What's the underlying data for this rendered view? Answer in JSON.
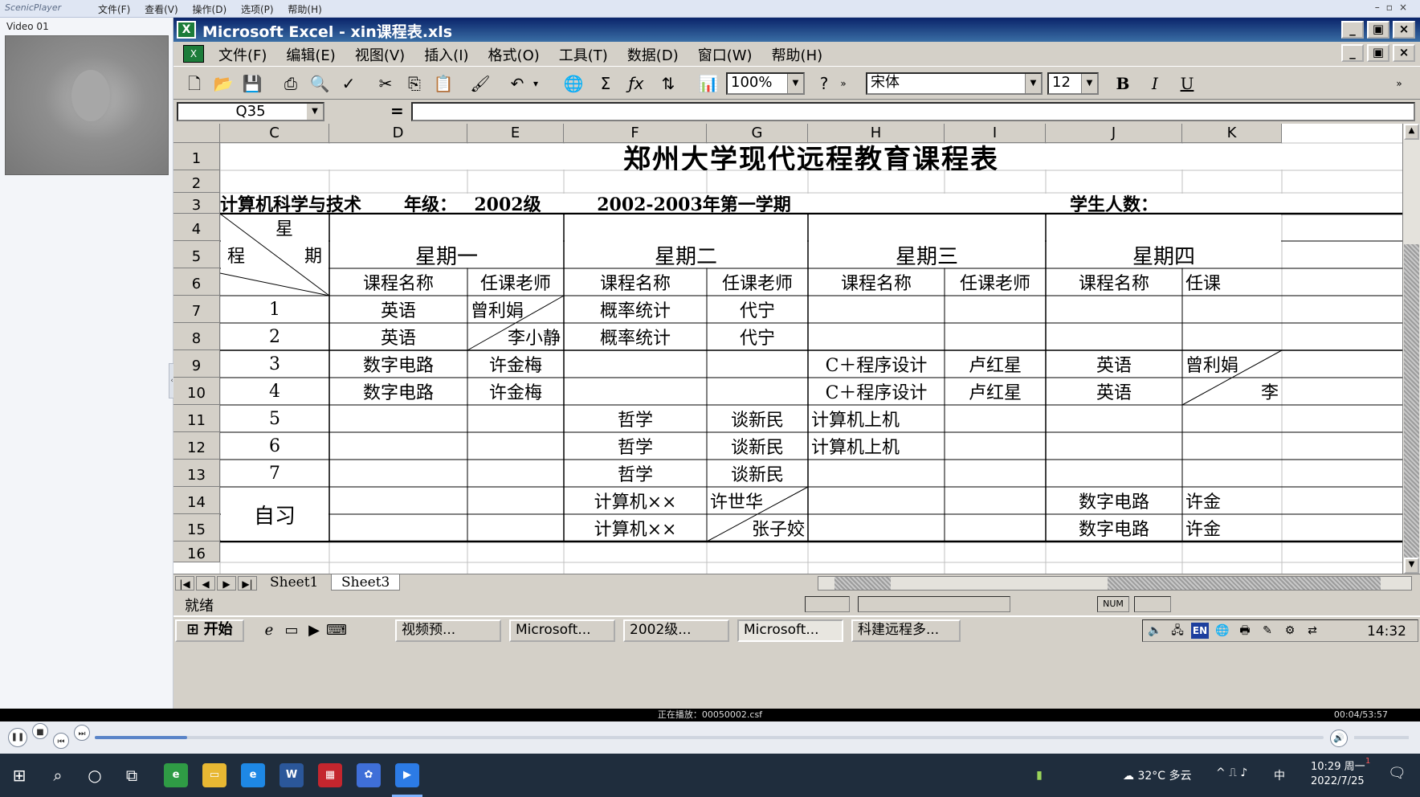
{
  "player": {
    "app_name": "ScenicPlayer",
    "menu": [
      "文件(F)",
      "查看(V)",
      "操作(D)",
      "选项(P)",
      "帮助(H)"
    ],
    "video_label": "Video 01",
    "now_playing": "正在播放：00050002.csf",
    "time": "00:04/53:57",
    "progress_fraction": 0.075
  },
  "excel": {
    "title": "Microsoft Excel - xin课程表.xls",
    "menu": [
      "文件(F)",
      "编辑(E)",
      "视图(V)",
      "插入(I)",
      "格式(O)",
      "工具(T)",
      "数据(D)",
      "窗口(W)",
      "帮助(H)"
    ],
    "zoom": "100%",
    "font_name": "宋体",
    "font_size": "12",
    "name_box": "Q35",
    "formula_equals": "=",
    "columns": [
      "C",
      "D",
      "E",
      "F",
      "G",
      "H",
      "I",
      "J",
      "K"
    ],
    "rows": [
      "1",
      "2",
      "3",
      "4",
      "5",
      "6",
      "7",
      "8",
      "9",
      "10",
      "11",
      "12",
      "13",
      "14",
      "15",
      "16"
    ],
    "sheet": {
      "title": "郑州大学现代远程教育课程表",
      "major": "计算机科学与技术",
      "grade_label": "年级：",
      "grade_value": "2002级",
      "term": "2002-2003年第一学期",
      "students_label": "学生人数：",
      "corner_star": "星",
      "corner_course": "程",
      "corner_period": "期",
      "days": [
        "星期一",
        "星期二",
        "星期三",
        "星期四"
      ],
      "course_header": "课程名称",
      "teacher_header": "任课老师",
      "teacher_header_partial": "任课",
      "periods": [
        "1",
        "2",
        "3",
        "4",
        "5",
        "6",
        "7"
      ],
      "self_study": "自习",
      "cells": {
        "d7": "英语",
        "e7": "曾利娟",
        "f7": "概率统计",
        "g7": "代宁",
        "d8": "英语",
        "e8": "李小静",
        "f8": "概率统计",
        "g8": "代宁",
        "d9": "数字电路",
        "e9": "许金梅",
        "h9": "C＋程序设计",
        "i9": "卢红星",
        "j9": "英语",
        "k9": "曾利娟",
        "d10": "数字电路",
        "e10": "许金梅",
        "h10": "C＋程序设计",
        "i10": "卢红星",
        "j10": "英语",
        "k10": "李",
        "f11": "哲学",
        "g11": "谈新民",
        "h11": "计算机上机",
        "f12": "哲学",
        "g12": "谈新民",
        "h12": "计算机上机",
        "f13": "哲学",
        "g13": "谈新民",
        "f14": "计算机××",
        "g14": "许世华",
        "j14": "数字电路",
        "k14": "许金",
        "f15": "计算机××",
        "g15": "张子姣",
        "j15": "数字电路",
        "k15": "许金"
      }
    },
    "sheet_tabs": [
      "Sheet1",
      "Sheet3"
    ],
    "status": "就绪",
    "status_num": "NUM"
  },
  "xp_taskbar": {
    "start": "开始",
    "tasks": [
      "视频预...",
      "Microsoft...",
      "2002级...",
      "Microsoft...",
      "科建远程多..."
    ],
    "lang": "EN",
    "clock": "14:32"
  },
  "win_taskbar": {
    "weather": "32°C 多云",
    "ime": "中",
    "time": "10:29 周一",
    "date": "2022/7/25",
    "notification_count": "1"
  }
}
